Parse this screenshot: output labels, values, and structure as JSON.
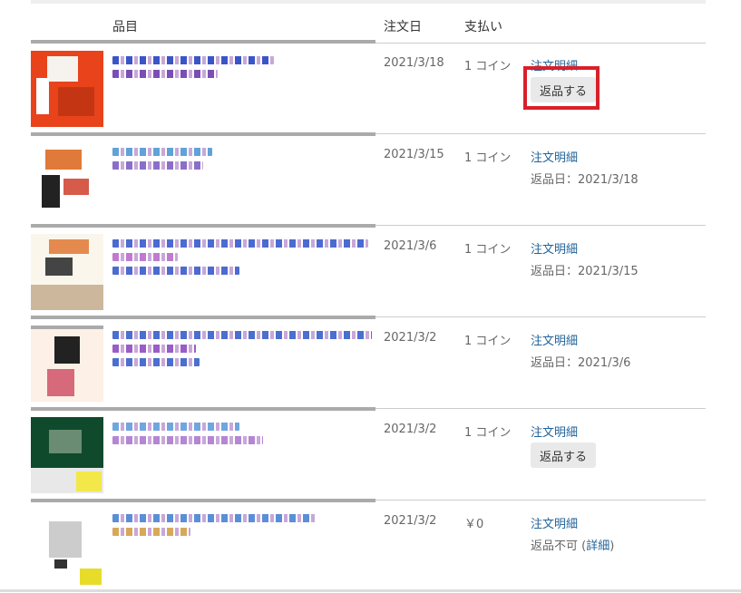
{
  "header": {
    "item_label": "品目",
    "date_label": "注文日",
    "payment_label": "支払い"
  },
  "orders": [
    {
      "date": "2021/3/18",
      "payment": "1 コイン",
      "detail_link": "注文明細",
      "action": "button",
      "return_button": "返品する",
      "thumb_colors": [
        "#e8431b",
        "#f6f2ee",
        "#c43613",
        "#ffffff"
      ],
      "title_colors": [
        "#3a55c8",
        "#7a4fb5"
      ]
    },
    {
      "date": "2021/3/15",
      "payment": "1 コイン",
      "detail_link": "注文明細",
      "action": "status",
      "status_text": "返品日：2021/3/18",
      "thumb_colors": [
        "#ffffff",
        "#e07a3a",
        "#222222",
        "#d65b4a"
      ],
      "title_colors": [
        "#5fa3d9",
        "#8a6fc9"
      ]
    },
    {
      "date": "2021/3/6",
      "payment": "1 コイン",
      "detail_link": "注文明細",
      "action": "status",
      "status_text": "返品日：2021/3/15",
      "thumb_colors": [
        "#fbf6ec",
        "#e58a4f",
        "#444444",
        "#cdb79c"
      ],
      "title_colors": [
        "#4b6bd1",
        "#c07bd0"
      ]
    },
    {
      "date": "2021/3/2",
      "payment": "1 コイン",
      "detail_link": "注文明細",
      "action": "status",
      "status_text": "返品日：2021/3/6",
      "thumb_colors": [
        "#fdf0e6",
        "#222222",
        "#d66a7a",
        "#aaaaaa"
      ],
      "title_colors": [
        "#4a6fcf",
        "#9a5cc7"
      ]
    },
    {
      "date": "2021/3/2",
      "payment": "1 コイン",
      "detail_link": "注文明細",
      "action": "button",
      "return_button": "返品する",
      "thumb_colors": [
        "#0f4a2c",
        "#e8e8e8",
        "#f2e84a",
        "#6a8c72"
      ],
      "title_colors": [
        "#6fa6e0",
        "#b586d4"
      ]
    },
    {
      "date": "2021/3/2",
      "payment": "￥0",
      "detail_link": "注文明細",
      "action": "status-link",
      "status_prefix": "返品不可 (",
      "status_link": "詳細",
      "status_suffix": ")",
      "thumb_colors": [
        "#ffffff",
        "#cccccc",
        "#e8dc2a",
        "#333333"
      ],
      "title_colors": [
        "#5a8fd8",
        "#d7a85a"
      ]
    }
  ]
}
